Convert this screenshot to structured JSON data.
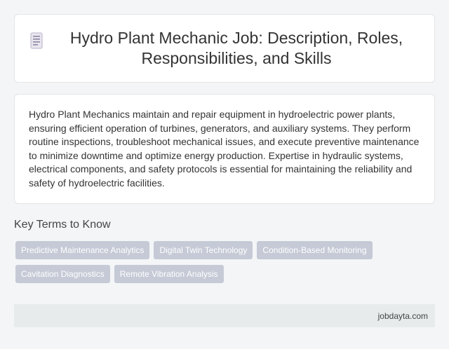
{
  "header": {
    "title": "Hydro Plant Mechanic Job: Description, Roles, Responsibilities, and Skills",
    "icon": "document-icon"
  },
  "description": "Hydro Plant Mechanics maintain and repair equipment in hydroelectric power plants, ensuring efficient operation of turbines, generators, and auxiliary systems. They perform routine inspections, troubleshoot mechanical issues, and execute preventive maintenance to minimize downtime and optimize energy production. Expertise in hydraulic systems, electrical components, and safety protocols is essential for maintaining the reliability and safety of hydroelectric facilities.",
  "key_terms": {
    "heading": "Key Terms to Know",
    "items": [
      "Predictive Maintenance Analytics",
      "Digital Twin Technology",
      "Condition-Based Monitoring",
      "Cavitation Diagnostics",
      "Remote Vibration Analysis"
    ]
  },
  "footer": {
    "site": "jobdayta.com"
  },
  "colors": {
    "tag_background": "#c5cad6",
    "footer_background": "#e7ebec",
    "page_background": "#f4f5f7"
  }
}
